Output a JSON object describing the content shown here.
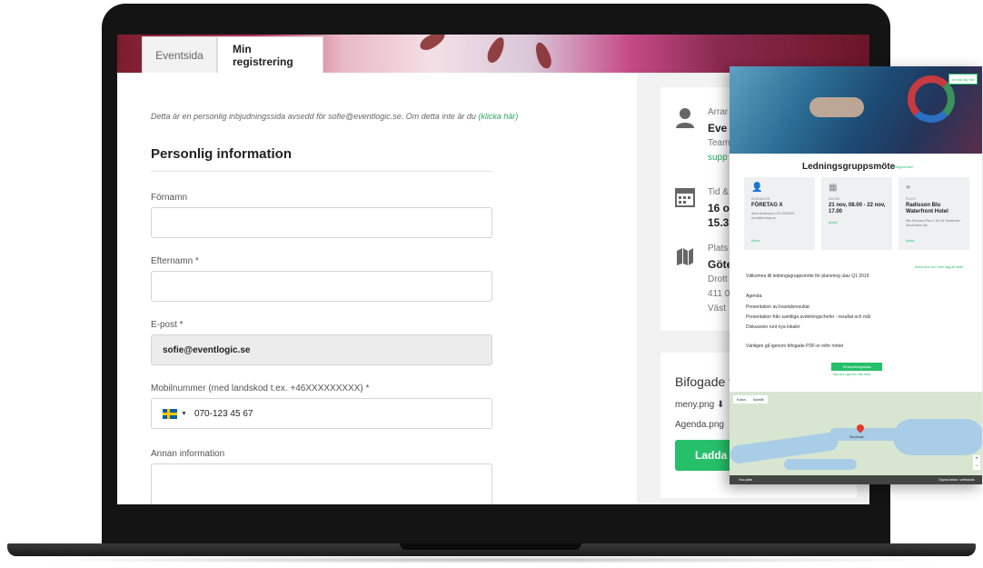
{
  "tabs": [
    {
      "label": "Eventsida",
      "active": false
    },
    {
      "label": "Min registrering",
      "active": true
    }
  ],
  "form": {
    "intro_text": "Detta är en personlig inbjudningssida avsedd för sofie@eventlogic.se. Om detta inte är du ",
    "intro_link": "(klicka här)",
    "section_title": "Personlig information",
    "fields": [
      {
        "label": "Förnamn",
        "value": ""
      },
      {
        "label": "Efternamn *",
        "value": ""
      },
      {
        "label": "E-post *",
        "value": "sofie@eventlogic.se"
      },
      {
        "label": "Mobilnummer (med landskod t.ex. +46XXXXXXXXX) *",
        "value": "070-123 45 67"
      },
      {
        "label": "Annan information",
        "value": ""
      }
    ]
  },
  "sidebar": {
    "organizer_label": "Arrar",
    "organizer_name": "Eve",
    "organizer_team": "Team",
    "organizer_link": "supp",
    "time_label": "Tid &",
    "time_line1": "16 o",
    "time_line2": "15.3",
    "place_label": "Plats",
    "place_name": "Göte",
    "place_line1": "Drott",
    "place_line2": "411 0",
    "place_line3": "Väst",
    "attachments_title": "Bifogade f",
    "files": [
      "meny.png",
      "Agenda.png"
    ],
    "register_button": "Ladda"
  },
  "preview": {
    "top_button": "Anmäl dig här",
    "title": "Ledningsgruppsmöte",
    "edit_link": "Redigera titel",
    "boxes": [
      {
        "label": "ARRANGÖR",
        "value": "FÖRETAG X",
        "details": "Anna Andersson 070-0000000 anna@foretag.se",
        "link": "Ändra"
      },
      {
        "label": "DATUM",
        "value": "21 nov, 08.00 - 22 nov, 17.00",
        "details": "",
        "link": "Ändra"
      },
      {
        "label": "PLATS",
        "value": "Radisson Blu Waterfront Hotel",
        "details": "Nils Ericsons Plan 4 111 64 Stockholm Stockholms län",
        "link": "Ändra"
      }
    ],
    "top_right_links": "Ändra text och / eller lägg till bilder",
    "welcome": "Välkomna till ledningsgruppsmöte för planering utav Q1 2019",
    "agenda_title": "Agenda:",
    "agenda_items": [
      "Presentation av kvartalsresultat",
      "Presentation från samtliga avdelningschefer - resultat och mål",
      "Diskussion runt nya lokaler"
    ],
    "closing": "Vänligen gå igenom bifogade PDF:er inför mötet",
    "register_btn": "Till anmälningssidan",
    "decline_link": "Nej tack, jag kan inte delta",
    "map_tabs": [
      "Karta",
      "Satellit"
    ],
    "map_city": "Stockholm",
    "map_footer_left": "Visa plats",
    "map_footer_right": "Öppna kartan i webbplats"
  },
  "colors": {
    "accent_green": "#27c06a",
    "link_green": "#2aa860"
  }
}
